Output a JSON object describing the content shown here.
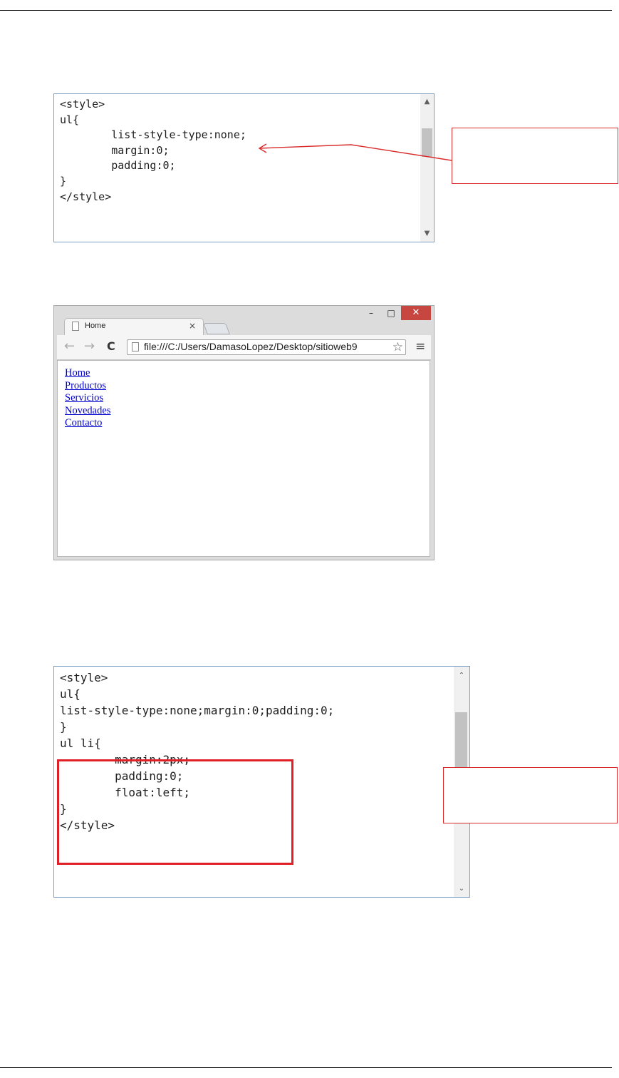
{
  "code_panel_1": {
    "lines": [
      "<style>",
      "",
      "ul{",
      "        list-style-type:none;",
      "        margin:0;",
      "        padding:0;",
      "}",
      "",
      "</style>"
    ]
  },
  "browser": {
    "tab_title": "Home",
    "tab_close": "×",
    "url": "file:///C:/Users/DamasoLopez/Desktop/sitioweb9",
    "window_controls": {
      "minimize": "–",
      "maximize": "□",
      "close": "✕"
    },
    "nav": {
      "back": "←",
      "forward": "→",
      "reload": "C"
    },
    "links": [
      "Home",
      "Productos",
      "Servicios",
      "Novedades",
      "Contacto"
    ]
  },
  "code_panel_2": {
    "lines": [
      "<style>",
      "",
      "ul{",
      "list-style-type:none;margin:0;padding:0;",
      "}",
      "",
      "ul li{",
      "        margin:2px;",
      "        padding:0;",
      "        float:left;",
      "}",
      "",
      "</style>"
    ]
  },
  "icons": [
    "scroll-up-icon",
    "scroll-down-icon",
    "page-icon",
    "star-icon",
    "menu-icon",
    "arrow-icon"
  ],
  "colors": {
    "annotation_red": "#d92b2b",
    "link_blue": "#0000cc",
    "close_button": "#c7463f"
  }
}
